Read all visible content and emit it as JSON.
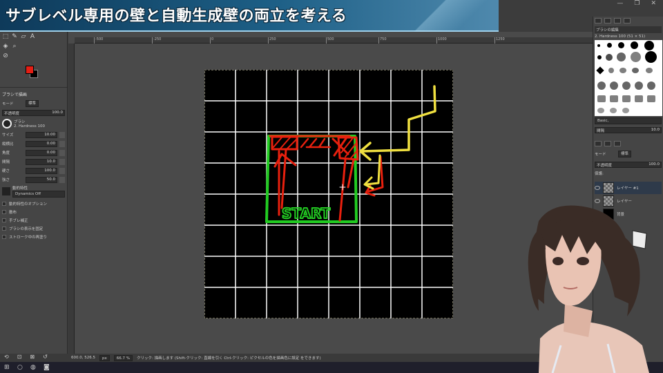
{
  "title_banner": {
    "text": "サブレベル専用の壁と自動生成壁の両立を考える"
  },
  "toolbox": {
    "tool_options_title": "ブラシで描画",
    "mode_label": "モード",
    "mode_value": "標準",
    "opacity_label": "不透明度",
    "opacity_value": "100.0",
    "brush_label": "ブラシ",
    "brush_value": "2. Hardness 100",
    "options": [
      {
        "label": "サイズ",
        "value": "10.00"
      },
      {
        "label": "縦横比",
        "value": "0.00"
      },
      {
        "label": "角度",
        "value": "0.00"
      },
      {
        "label": "間隔",
        "value": "10.0"
      },
      {
        "label": "硬さ",
        "value": "100.0"
      },
      {
        "label": "強さ",
        "value": "50.0"
      }
    ],
    "dynamics_label": "動的特性",
    "dynamics_value": "Dynamics Off",
    "checkboxes": [
      "動的特性のオプション",
      "散布",
      "手ブレ補正",
      "ブラシの表示を固定",
      "ストローク中の再塗り"
    ]
  },
  "ruler": {
    "ticks": [
      "-500",
      "-250",
      "0",
      "250",
      "500",
      "750",
      "1000",
      "1250"
    ]
  },
  "canvas": {
    "grid_cols": 8,
    "grid_rows": 8,
    "start_label": "START",
    "colors": {
      "background": "#000000",
      "grid": "#ffffff",
      "green": "#22cc22",
      "red": "#e8200e",
      "yellow": "#f0e040"
    }
  },
  "statusbar": {
    "coords": "600.0, 526.5",
    "unit": "px",
    "zoom": "66.7 %",
    "hint": "クリック: 描画します (Shift-クリック: 直線を引く Ctrl-クリック: ピクセルの色を描画色に設定 をできます)"
  },
  "dock": {
    "brush_tab": "ブラシの編集",
    "brush_name": "2. Hardness 100 (51 × 51)",
    "brush_filter": "Basic,",
    "spacing_label": "間隔",
    "spacing_value": "10.0",
    "mode_label": "モード",
    "mode_value": "標準",
    "opacity_label": "不透明度",
    "opacity_value": "100.0",
    "lock_label": "保護:",
    "layers": [
      {
        "name": "レイヤー #1",
        "active": true
      },
      {
        "name": "レイヤー",
        "active": false
      },
      {
        "name": "背景",
        "active": false
      }
    ]
  },
  "window": {
    "controls": [
      "—",
      "❐",
      "✕"
    ]
  },
  "colors": {
    "foreground": "#e41e14",
    "background": "#000000"
  }
}
